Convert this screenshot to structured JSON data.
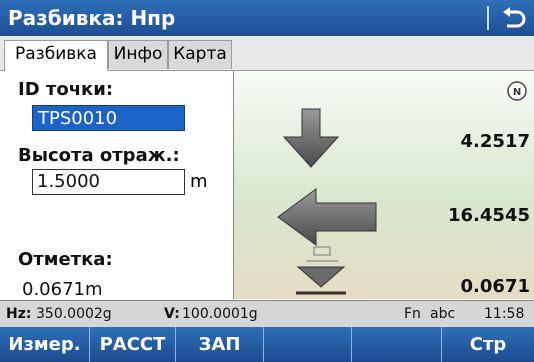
{
  "app": {
    "title": "Разбивка: Hпр"
  },
  "tabs": [
    {
      "label": "Разбивка",
      "active": true
    },
    {
      "label": "Инфо",
      "active": false
    },
    {
      "label": "Карта",
      "active": false
    }
  ],
  "form": {
    "point_id_label": "ID точки:",
    "point_id_value": "TPS0010",
    "refl_height_label": "Высота отраж.:",
    "refl_height_value": "1.5000",
    "refl_height_unit": "m",
    "elevation_label": "Отметка:",
    "elevation_value": "0.0671m"
  },
  "graphic": {
    "icon": "north-indicator-icon",
    "values": [
      "4.2517",
      "16.4545",
      "0.0671"
    ]
  },
  "status": {
    "hz_label": "Hz:",
    "hz_value": "350.0002g",
    "v_label": "V:",
    "v_value": "100.0001g",
    "fn": "Fn",
    "input_mode": "abc",
    "time": "11:58"
  },
  "fkeys": [
    "Измер.",
    "РАССТ",
    "ЗАП",
    "",
    "",
    "Стр"
  ],
  "colors": {
    "title_bar": "#1d4f96",
    "selected_field": "#1c63c8",
    "arrow": "#555555"
  }
}
